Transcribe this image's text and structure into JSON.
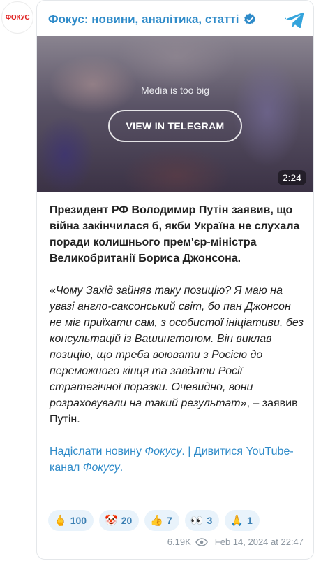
{
  "avatar": {
    "label": "ФОКУС"
  },
  "header": {
    "channel_name": "Фокус: новини, аналітика, статті"
  },
  "media": {
    "note": "Media is too big",
    "view_button": "VIEW IN TELEGRAM",
    "duration": "2:24"
  },
  "post": {
    "lead": "Президент РФ Володимир Путін заявив, що війна закінчилася б, якби Україна не слухала поради колишнього прем'єр-міністра Великобританії Бориса Джонсона.",
    "quote_open": "«",
    "quote_italic": "Чому Захід зайняв таку позицію? Я маю на увазі англо-саксонський світ, бо пан Джонсон не міг приїхати сам, з особистої ініціативи, без консультацій із Вашингтоном. Він виклав позицію, що треба воювати з Росією до переможного кінця та завдати Росії стратегічної поразки. Очевидно, вони розраховували на такий результат",
    "quote_tail": "», – заявив Путін.",
    "link1_text": "Надіслати новину ",
    "link1_em": "Фокусу",
    "link1_end": ".",
    "separator": " | ",
    "link2_text": "Дивитися YouTube-канал ",
    "link2_em": "Фокусу",
    "link2_end": "."
  },
  "reactions": [
    {
      "emoji": "🖕",
      "count": "100"
    },
    {
      "emoji": "🤡",
      "count": "20"
    },
    {
      "emoji": "👍",
      "count": "7"
    },
    {
      "emoji": "👀",
      "count": "3"
    },
    {
      "emoji": "🙏",
      "count": "1"
    }
  ],
  "meta": {
    "views": "6.19K",
    "date": "Feb 14, 2024 at 22:47"
  },
  "colors": {
    "accent": "#2f8bc9",
    "text": "#222222",
    "muted": "#8c96a0",
    "reaction_bg": "#e9f3fb"
  }
}
